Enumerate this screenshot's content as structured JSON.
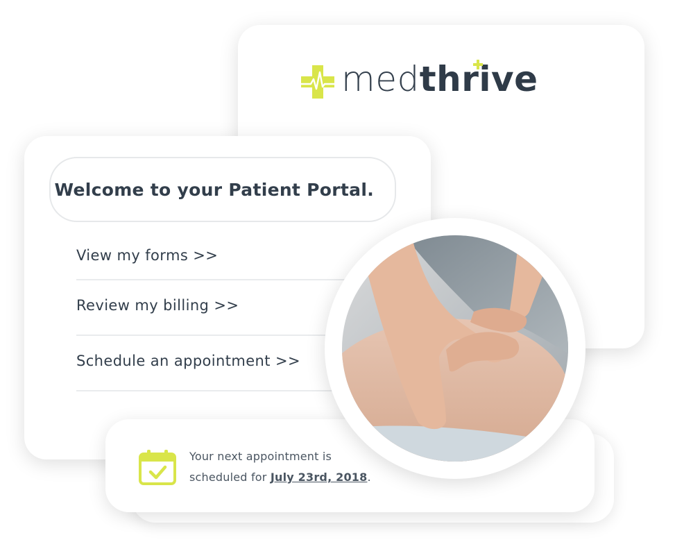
{
  "brand": {
    "name_light": "med",
    "name_bold": "thrive",
    "accent_color": "#d9e54a",
    "text_color": "#2f3b48"
  },
  "portal": {
    "welcome": "Welcome to your Patient Portal.",
    "menu": [
      {
        "label": "View my forms >>"
      },
      {
        "label": "Review my billing >>"
      },
      {
        "label": "Schedule an appointment >>"
      }
    ]
  },
  "appointment": {
    "line1": "Your next appointment is",
    "line2_prefix": "scheduled for ",
    "date": "July 23rd, 2018",
    "suffix": ".",
    "icon": "calendar-check-icon"
  },
  "photo": {
    "icon": "massage-photo"
  }
}
